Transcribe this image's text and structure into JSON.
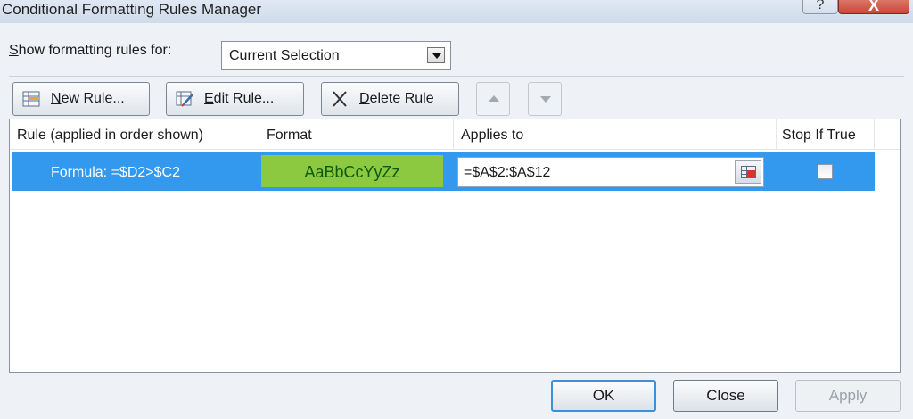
{
  "window": {
    "title": "Conditional Formatting Rules Manager",
    "help_label": "?",
    "close_label": "X"
  },
  "show_rules": {
    "label_accel": "S",
    "label_rest": "how formatting rules for:",
    "selected": "Current Selection"
  },
  "toolbar": {
    "new_rule": {
      "accel": "N",
      "rest": "ew Rule..."
    },
    "edit_rule": {
      "accel": "E",
      "rest": "dit Rule..."
    },
    "delete_rule": {
      "accel": "D",
      "rest": "elete Rule"
    },
    "move_up_icon": "arrow-up-icon",
    "move_down_icon": "arrow-down-icon"
  },
  "table": {
    "headers": [
      "Rule (applied in order shown)",
      "Format",
      "Applies to",
      "Stop If True"
    ],
    "rows": [
      {
        "rule": "Formula: =$D2>$C2",
        "format_preview": "AaBbCcYyZz",
        "format_fill": "#8cc840",
        "applies_to": "=$A$2:$A$12",
        "stop_if_true": false,
        "selected": true
      }
    ],
    "selection_color": "#3399ee"
  },
  "buttons": {
    "ok": "OK",
    "close": "Close",
    "apply": "Apply",
    "apply_enabled": false
  }
}
